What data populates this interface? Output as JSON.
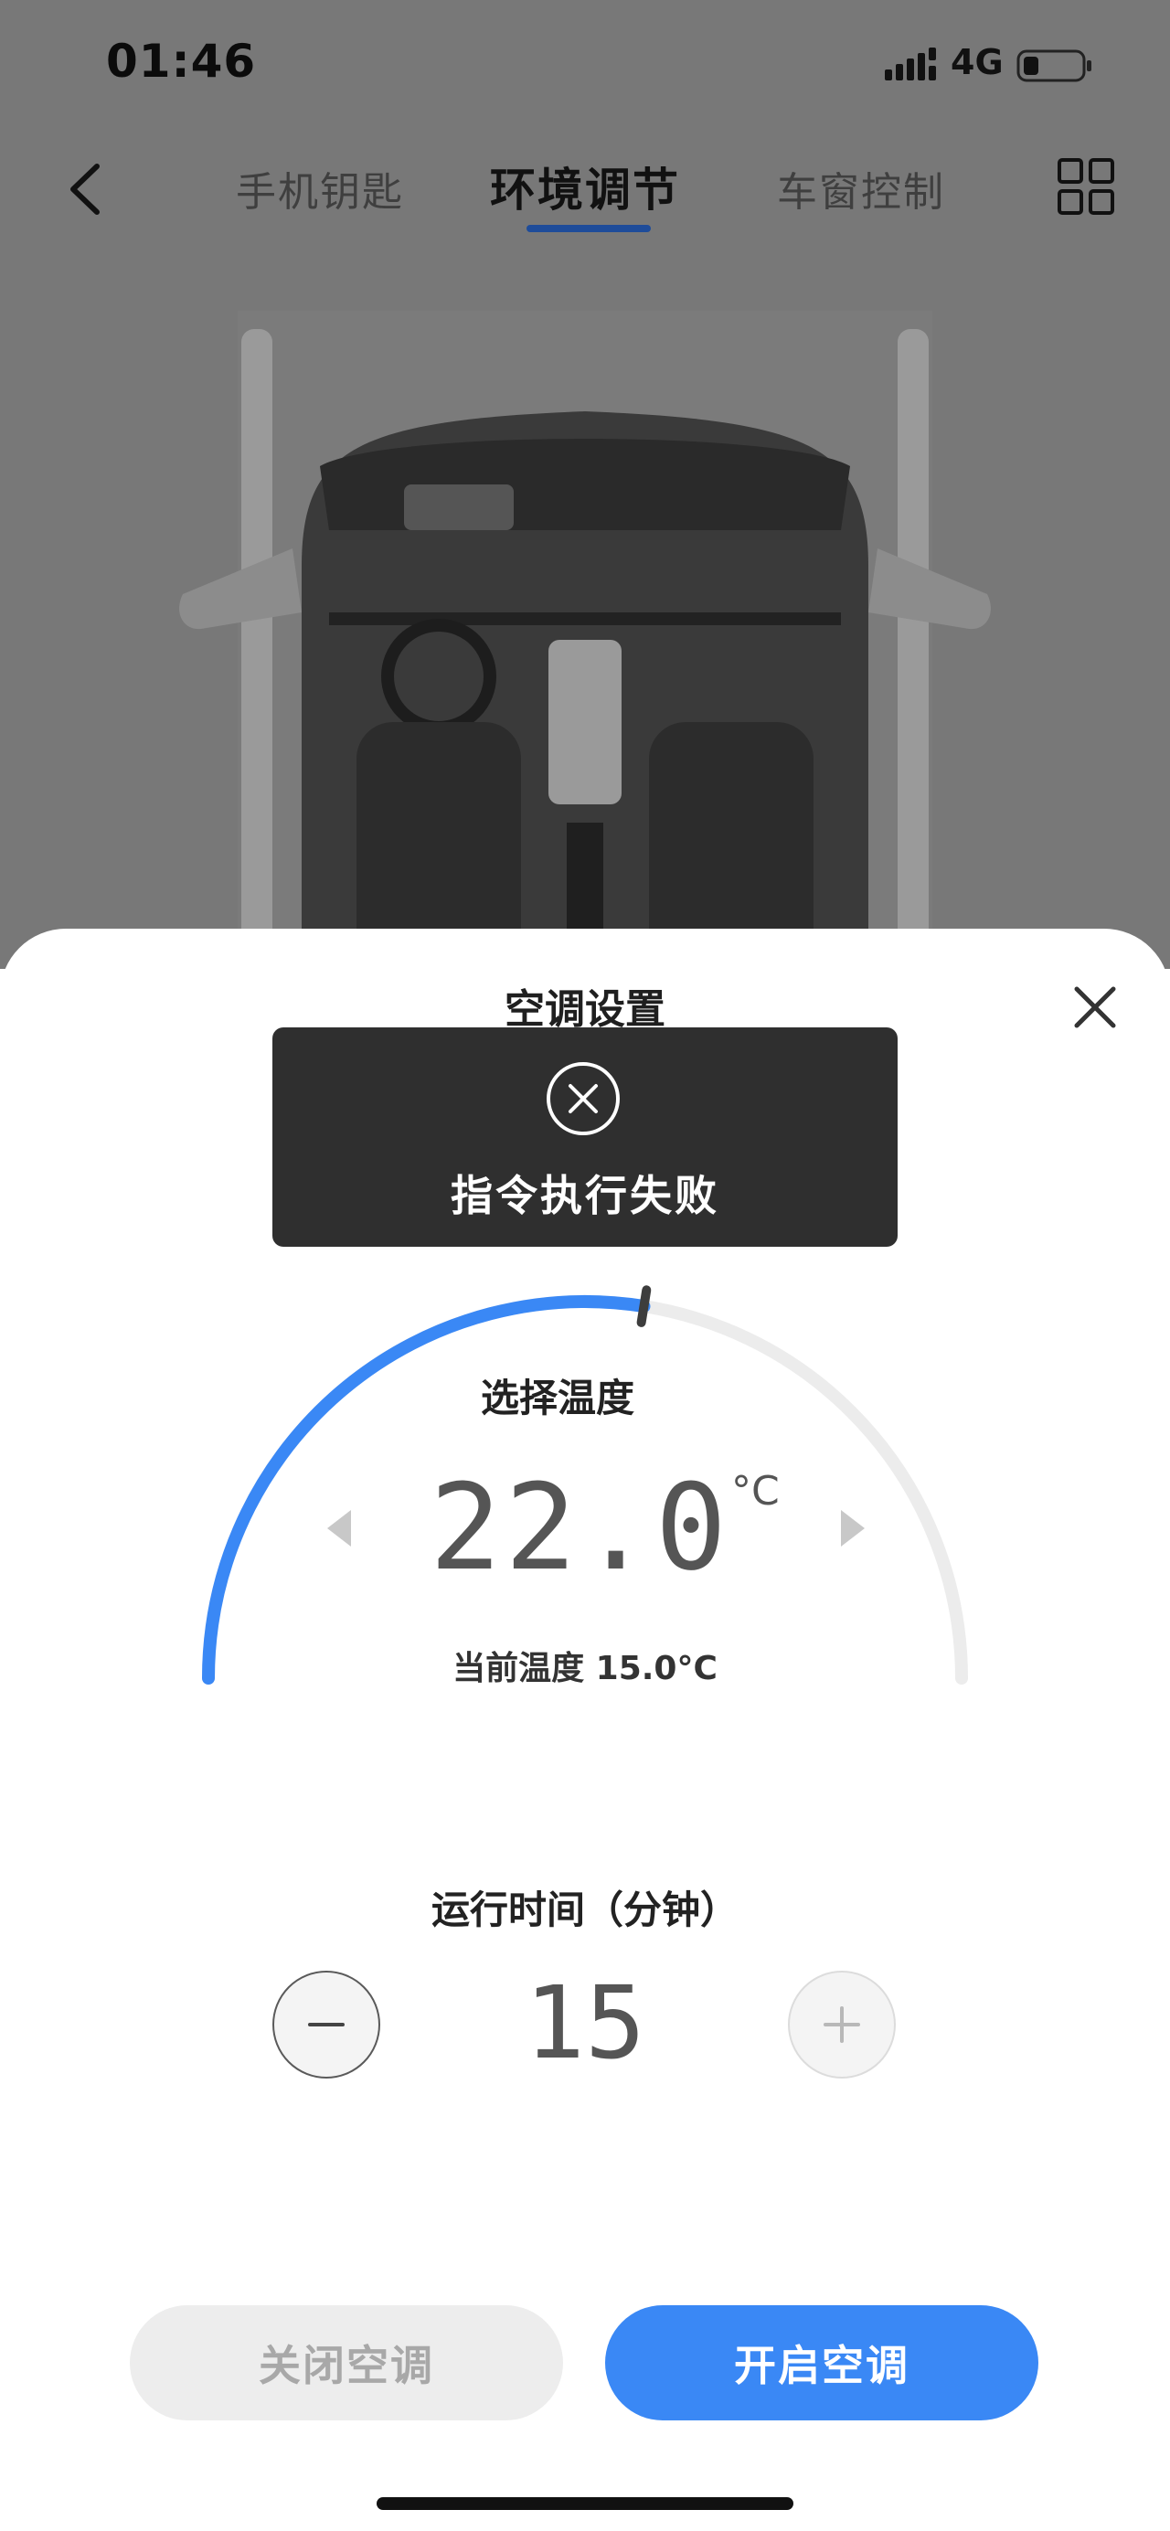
{
  "status_bar": {
    "time": "01:46",
    "network": "4G"
  },
  "nav": {
    "tabs": [
      {
        "label": "手机钥匙"
      },
      {
        "label": "环境调节"
      },
      {
        "label": "车窗控制"
      }
    ],
    "active_tab": "环境调节"
  },
  "sheet": {
    "title": "空调设置",
    "temperature": {
      "caption": "选择温度",
      "value": "22.0",
      "unit": "°C",
      "current": "当前温度 15.0°C",
      "dial_fill_fraction": 0.55
    },
    "run_time": {
      "label": "运行时间（分钟）",
      "value": "15"
    },
    "buttons": {
      "off": "关闭空调",
      "on": "开启空调"
    }
  },
  "toast": {
    "message": "指令执行失败"
  },
  "colors": {
    "accent": "#3a88f5",
    "tab_underline": "#1e4c9a",
    "dim_overlay": "#787878",
    "toast_bg": "#2f2f2f"
  },
  "icons": [
    "back-arrow-icon",
    "grid-icon",
    "close-icon",
    "error-circle-icon",
    "chevron-left-icon",
    "chevron-right-icon",
    "minus-icon",
    "plus-icon",
    "signal-icon",
    "battery-icon"
  ]
}
